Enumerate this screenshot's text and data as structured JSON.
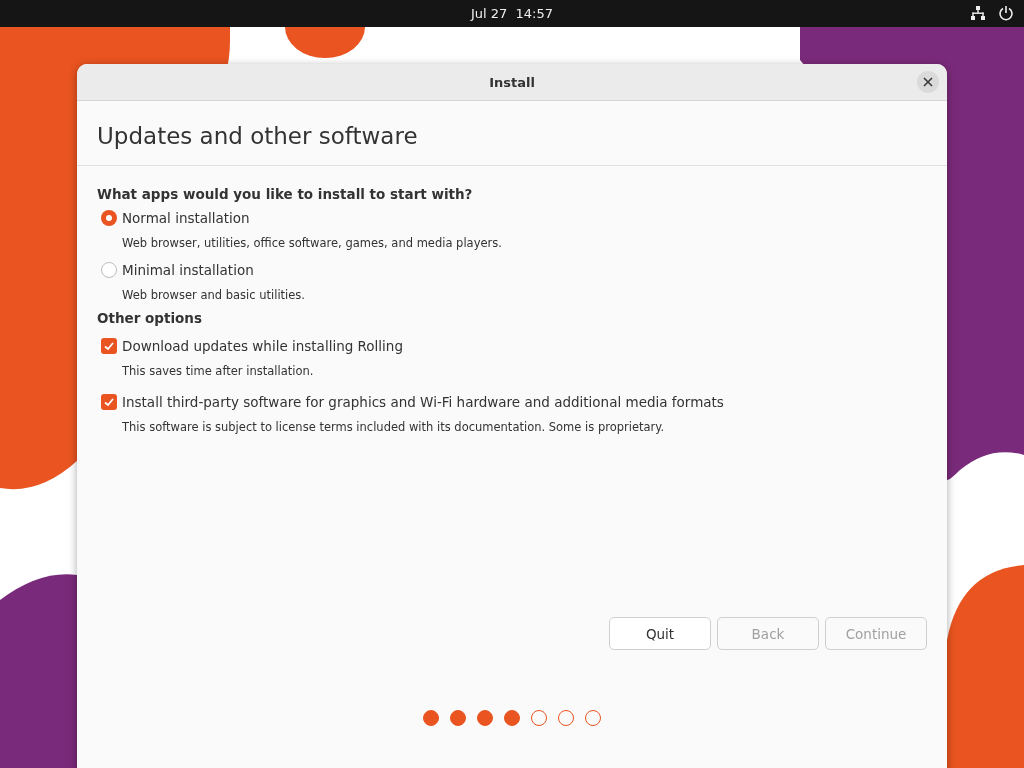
{
  "top_bar": {
    "clock": "Jul 27  14:57"
  },
  "window": {
    "title": "Install"
  },
  "page_title": "Updates and other software",
  "sections": [
    {
      "heading": "What apps would you like to install to start with?",
      "options": [
        {
          "kind": "radio",
          "label": "Normal installation",
          "description": "Web browser, utilities, office software, games, and media players.",
          "selected": true
        },
        {
          "kind": "radio",
          "label": "Minimal installation",
          "description": "Web browser and basic utilities.",
          "selected": false
        }
      ]
    },
    {
      "heading": "Other options",
      "options": [
        {
          "kind": "checkbox",
          "label": "Download updates while installing Rolling",
          "description": "This saves time after installation.",
          "checked": true
        },
        {
          "kind": "checkbox",
          "label": "Install third-party software for graphics and Wi-Fi hardware and additional media formats",
          "description": "This software is subject to license terms included with its documentation. Some is proprietary.",
          "checked": true
        }
      ]
    }
  ],
  "buttons": [
    {
      "label": "Quit",
      "disabled": false
    },
    {
      "label": "Back",
      "disabled": true
    },
    {
      "label": "Continue",
      "disabled": true
    }
  ],
  "steps": [
    {
      "done": true
    },
    {
      "done": true
    },
    {
      "done": true
    },
    {
      "done": true
    },
    {
      "done": false
    },
    {
      "done": false
    },
    {
      "done": false
    }
  ]
}
